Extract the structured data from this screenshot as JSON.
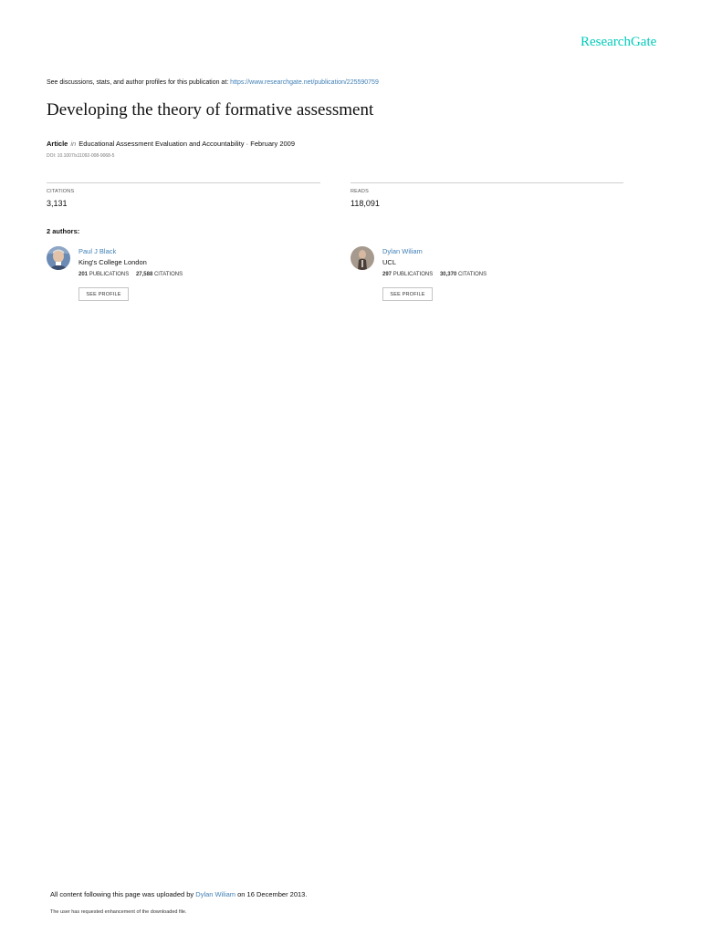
{
  "header": {
    "brand": "ResearchGate",
    "discussion_prefix": "See discussions, stats, and author profiles for this publication at: ",
    "discussion_link": "https://www.researchgate.net/publication/225590759"
  },
  "publication": {
    "title": "Developing the theory of formative assessment",
    "type": "Article",
    "in_word": "in",
    "journal": "Educational Assessment Evaluation and Accountability",
    "date_sep": " · ",
    "date": "February 2009",
    "doi": "DOI: 10.1007/s11092-008-9068-5"
  },
  "stats": {
    "citations_label": "CITATIONS",
    "citations_value": "3,131",
    "reads_label": "READS",
    "reads_value": "118,091"
  },
  "authors_heading": "2 authors:",
  "authors": [
    {
      "name": "Paul J Black",
      "institution": "King's College London",
      "publications": "201",
      "publications_label": "PUBLICATIONS",
      "citations": "27,588",
      "citations_label": "CITATIONS",
      "profile_button": "SEE PROFILE"
    },
    {
      "name": "Dylan Wiliam",
      "institution": "UCL",
      "publications": "297",
      "publications_label": "PUBLICATIONS",
      "citations": "30,370",
      "citations_label": "CITATIONS",
      "profile_button": "SEE PROFILE"
    }
  ],
  "footer": {
    "upload_prefix": "All content following this page was uploaded by ",
    "upload_user": "Dylan Wiliam",
    "upload_suffix": " on 16 December 2013.",
    "note": "The user has requested enhancement of the downloaded file."
  }
}
